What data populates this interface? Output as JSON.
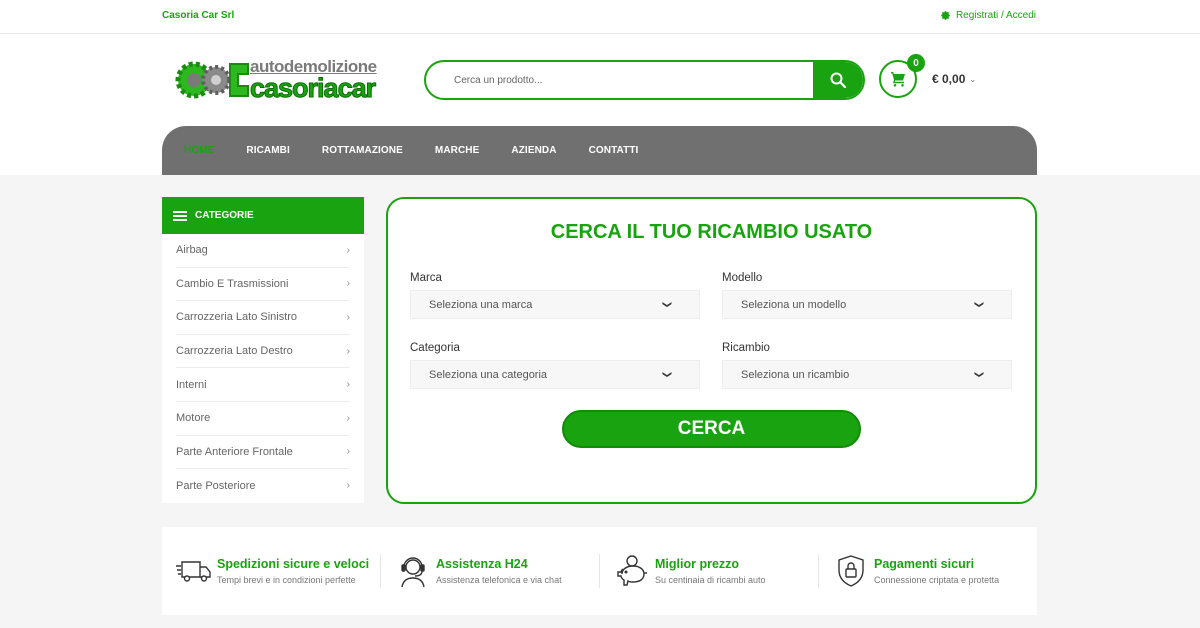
{
  "topbar": {
    "company": "Casoria Car Srl",
    "account_link": "Registrati / Accedi"
  },
  "logo": {
    "line1": "autodemolizione",
    "line2": "casoriacar"
  },
  "search": {
    "placeholder": "Cerca un prodotto..."
  },
  "cart": {
    "count": "0",
    "total": "€ 0,00"
  },
  "nav": {
    "items": [
      "HOME",
      "RICAMBI",
      "ROTTAMAZIONE",
      "MARCHE",
      "AZIENDA",
      "CONTATTI"
    ]
  },
  "sidebar": {
    "title": "CATEGORIE",
    "items": [
      "Airbag",
      "Cambio E Trasmissioni",
      "Carrozzeria Lato Sinistro",
      "Carrozzeria Lato Destro",
      "Interni",
      "Motore",
      "Parte Anteriore Frontale",
      "Parte Posteriore"
    ]
  },
  "finder": {
    "title": "CERCA IL TUO RICAMBIO USATO",
    "marca_label": "Marca",
    "marca_value": "Seleziona una marca",
    "modello_label": "Modello",
    "modello_value": "Seleziona un modello",
    "categoria_label": "Categoria",
    "categoria_value": "Seleziona una categoria",
    "ricambio_label": "Ricambio",
    "ricambio_value": "Seleziona un ricambio",
    "button": "CERCA"
  },
  "features": [
    {
      "title": "Spedizioni sicure e veloci",
      "subtitle": "Tempi brevi e in condizioni perfette",
      "icon": "truck-icon"
    },
    {
      "title": "Assistenza H24",
      "subtitle": "Assistenza telefonica e via chat",
      "icon": "headset-icon"
    },
    {
      "title": "Miglior prezzo",
      "subtitle": "Su centinaia di ricambi auto",
      "icon": "piggy-bank-icon"
    },
    {
      "title": "Pagamenti sicuri",
      "subtitle": "Connessione criptata e protetta",
      "icon": "shield-lock-icon"
    }
  ],
  "colors": {
    "brand_green": "#1aa310",
    "nav_gray": "#707070",
    "page_bg": "#f5f5f5"
  }
}
